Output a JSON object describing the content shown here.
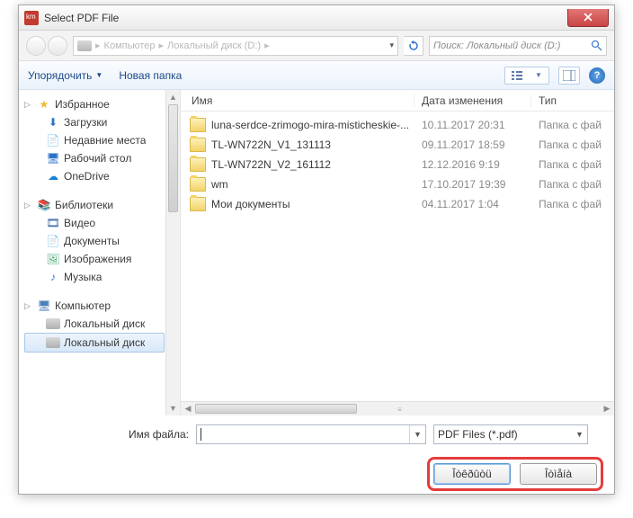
{
  "window": {
    "title": "Select PDF File"
  },
  "breadcrumb": {
    "computer": "Компьютер",
    "drive": "Локальный диск (D:)"
  },
  "search": {
    "placeholder": "Поиск: Локальный диск (D:)"
  },
  "toolbar": {
    "organize": "Упорядочить",
    "newfolder": "Новая папка"
  },
  "sidebar": {
    "favorites": {
      "label": "Избранное",
      "items": [
        "Загрузки",
        "Недавние места",
        "Рабочий стол",
        "OneDrive"
      ]
    },
    "libraries": {
      "label": "Библиотеки",
      "items": [
        "Видео",
        "Документы",
        "Изображения",
        "Музыка"
      ]
    },
    "computer": {
      "label": "Компьютер",
      "items": [
        "Локальный диск",
        "Локальный диск"
      ]
    }
  },
  "columns": {
    "name": "Имя",
    "date": "Дата изменения",
    "type": "Тип"
  },
  "rows": [
    {
      "name": "luna-serdce-zrimogo-mira-misticheskie-...",
      "date": "10.11.2017 20:31",
      "type": "Папка с фай"
    },
    {
      "name": "TL-WN722N_V1_131113",
      "date": "09.11.2017 18:59",
      "type": "Папка с фай"
    },
    {
      "name": "TL-WN722N_V2_161112",
      "date": "12.12.2016 9:19",
      "type": "Папка с фай"
    },
    {
      "name": "wm",
      "date": "17.10.2017 19:39",
      "type": "Папка с фай"
    },
    {
      "name": "Мои документы",
      "date": "04.11.2017 1:04",
      "type": "Папка с фай"
    }
  ],
  "footer": {
    "filename_label": "Имя файла:",
    "filename_value": "",
    "filter": "PDF Files (*.pdf)",
    "open": "Îòêðûòü",
    "cancel": "Îòìåíà"
  }
}
